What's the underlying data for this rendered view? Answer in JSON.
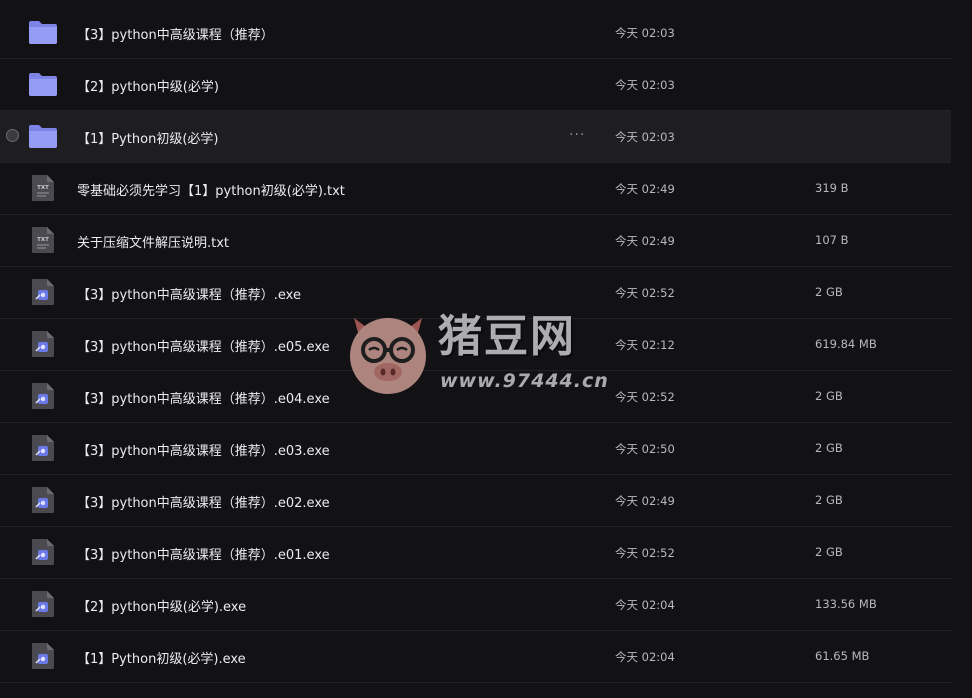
{
  "files": [
    {
      "name": "【3】python中高级课程（推荐）",
      "date": "今天 02:03",
      "size": "",
      "type": "folder"
    },
    {
      "name": "【2】python中级(必学)",
      "date": "今天 02:03",
      "size": "",
      "type": "folder"
    },
    {
      "name": "【1】Python初级(必学)",
      "date": "今天 02:03",
      "size": "",
      "type": "folder",
      "selected": true,
      "more": "···"
    },
    {
      "name": "零基础必须先学习【1】python初级(必学).txt",
      "date": "今天 02:49",
      "size": "319 B",
      "type": "txt"
    },
    {
      "name": "关于压缩文件解压说明.txt",
      "date": "今天 02:49",
      "size": "107 B",
      "type": "txt"
    },
    {
      "name": "【3】python中高级课程（推荐）.exe",
      "date": "今天 02:52",
      "size": "2 GB",
      "type": "exe"
    },
    {
      "name": "【3】python中高级课程（推荐）.e05.exe",
      "date": "今天 02:12",
      "size": "619.84 MB",
      "type": "exe"
    },
    {
      "name": "【3】python中高级课程（推荐）.e04.exe",
      "date": "今天 02:52",
      "size": "2 GB",
      "type": "exe"
    },
    {
      "name": "【3】python中高级课程（推荐）.e03.exe",
      "date": "今天 02:50",
      "size": "2 GB",
      "type": "exe"
    },
    {
      "name": "【3】python中高级课程（推荐）.e02.exe",
      "date": "今天 02:49",
      "size": "2 GB",
      "type": "exe"
    },
    {
      "name": "【3】python中高级课程（推荐）.e01.exe",
      "date": "今天 02:52",
      "size": "2 GB",
      "type": "exe"
    },
    {
      "name": "【2】python中级(必学).exe",
      "date": "今天 02:04",
      "size": "133.56 MB",
      "type": "exe"
    },
    {
      "name": "【1】Python初级(必学).exe",
      "date": "今天 02:04",
      "size": "61.65 MB",
      "type": "exe"
    }
  ],
  "watermark": {
    "title": "猪豆网",
    "url": "www.97444.cn"
  },
  "colors": {
    "background": "#121214",
    "selected_row": "#1e1e21",
    "folder_icon": "#8b93f0",
    "file_icon": "#4a4a50",
    "exe_badge": "#6a78e8"
  },
  "icons": {
    "folder": "folder-icon",
    "txt": "txt-file-icon",
    "exe": "exe-file-icon",
    "more": "more-options-icon"
  }
}
